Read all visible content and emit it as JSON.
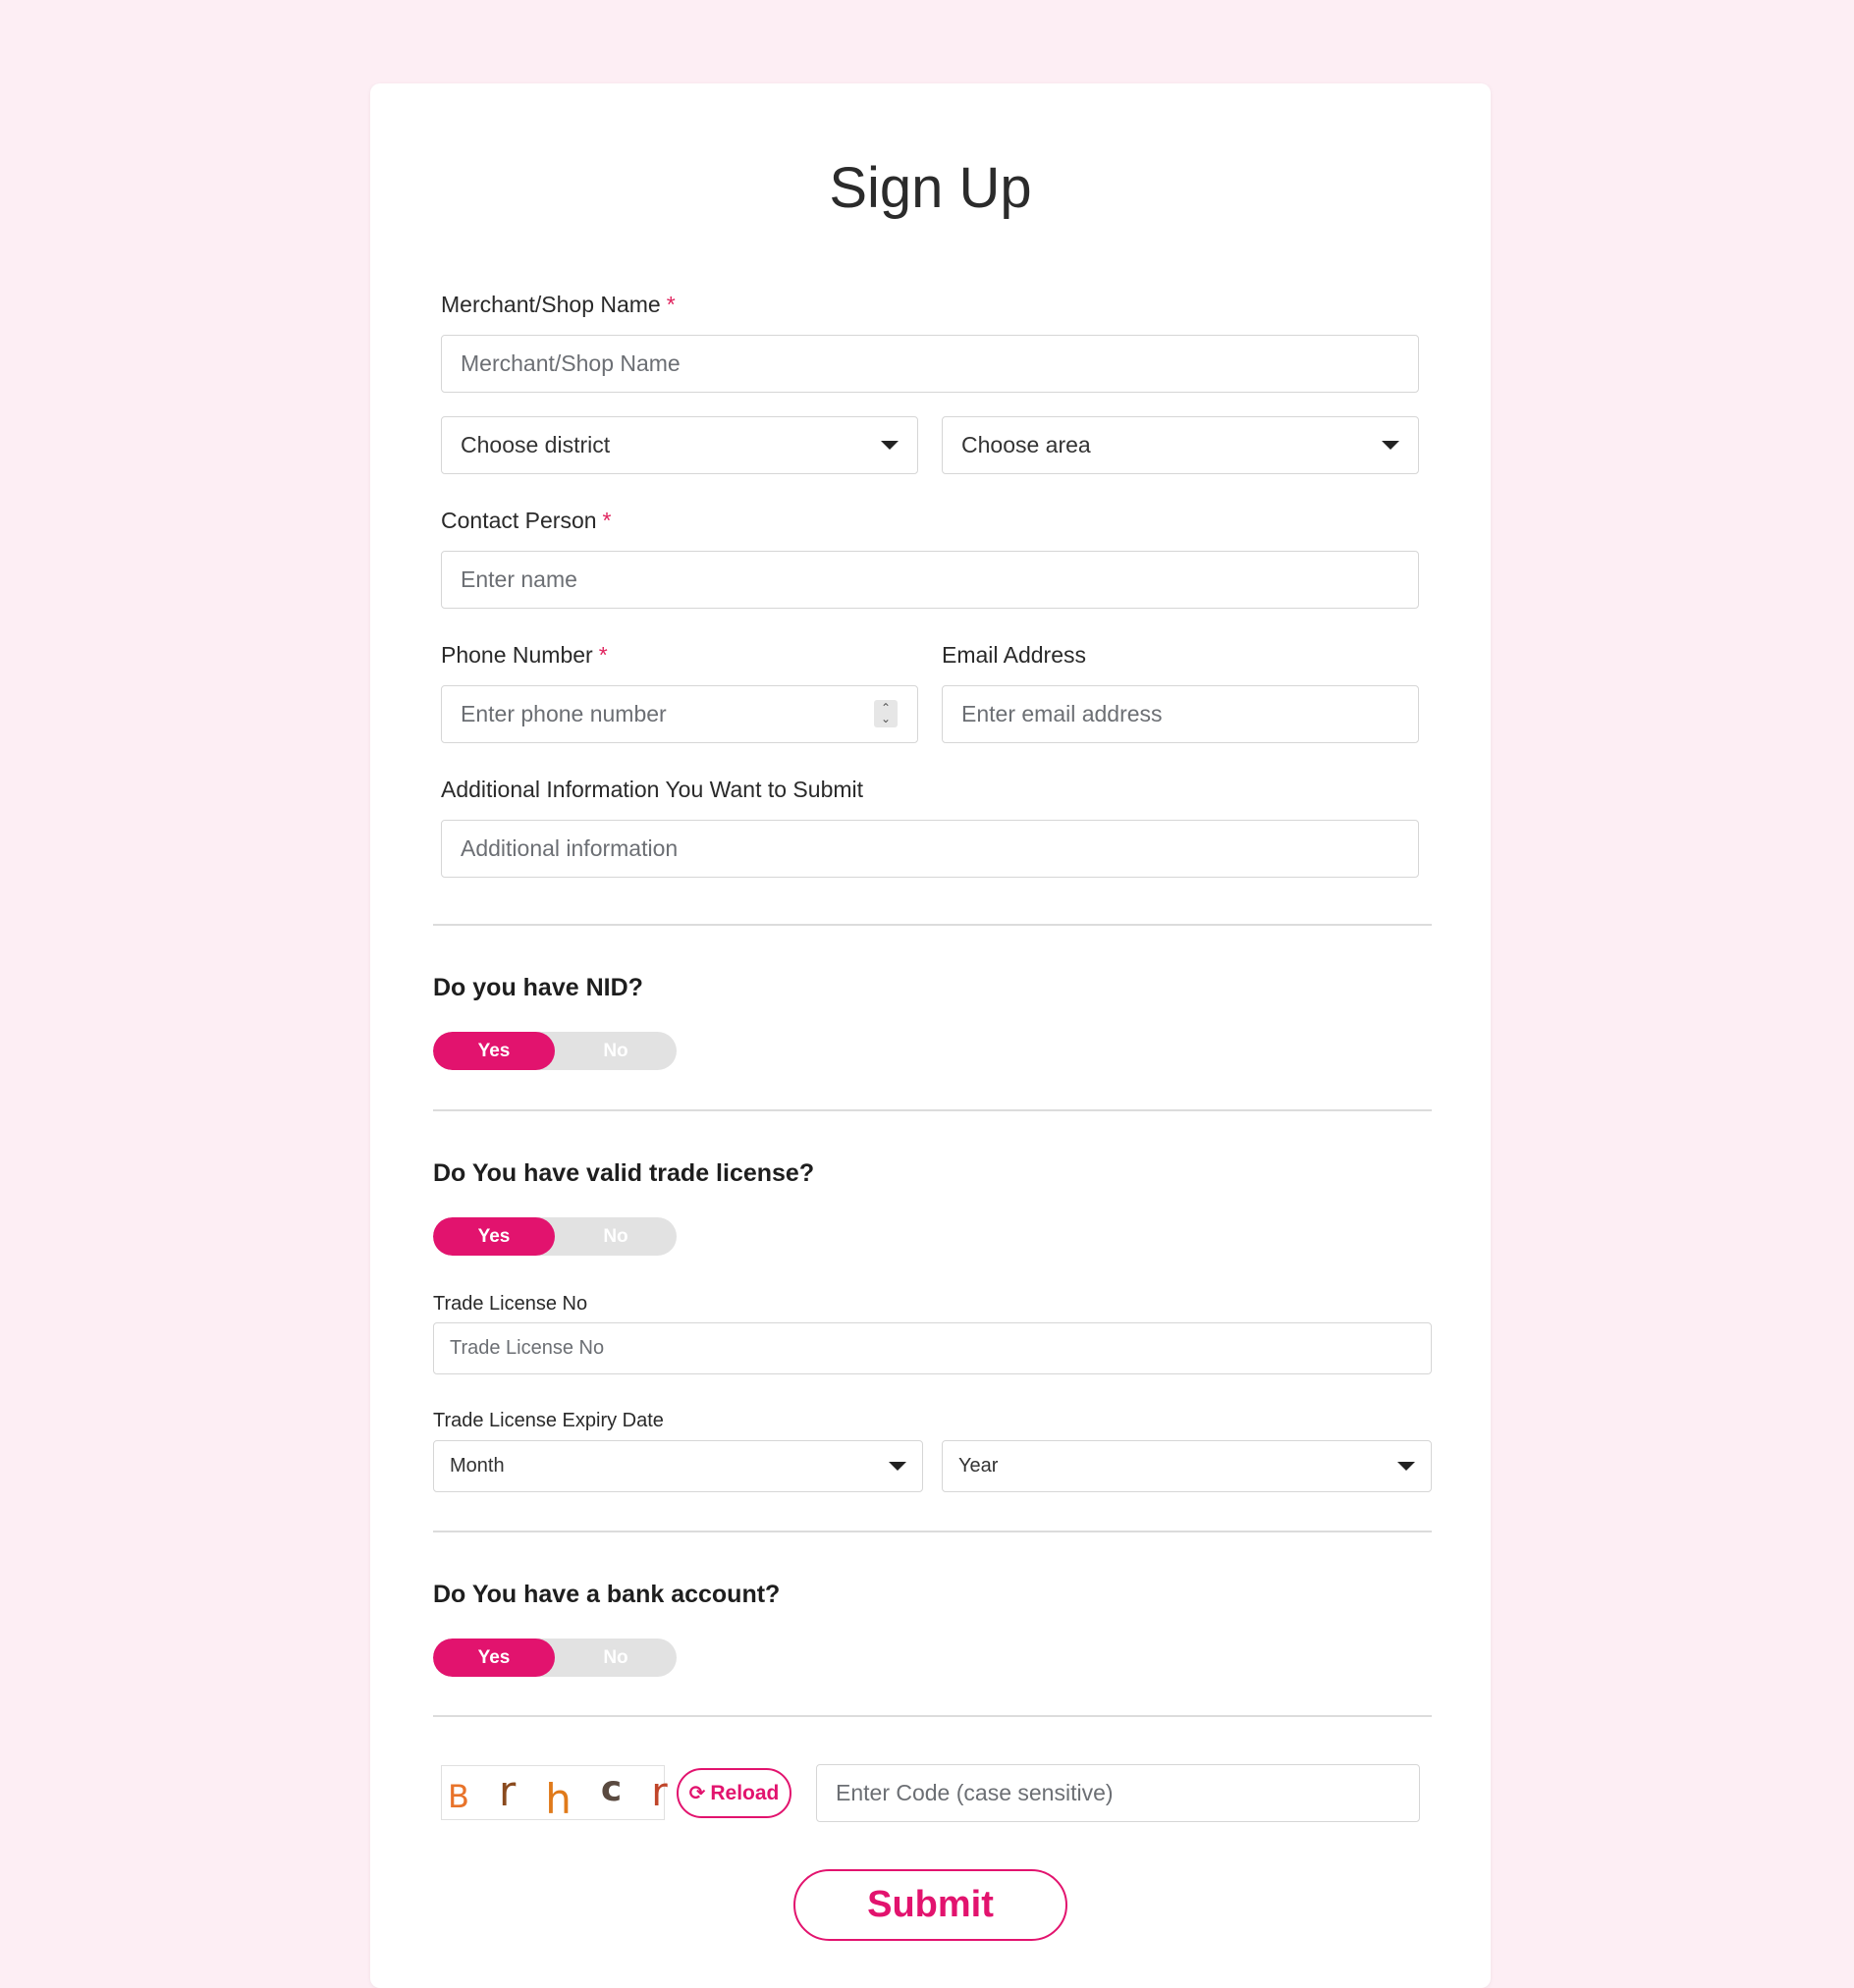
{
  "title": "Sign Up",
  "merchant": {
    "label": "Merchant/Shop Name",
    "required": "*",
    "placeholder": "Merchant/Shop Name"
  },
  "district": {
    "value": "Choose district"
  },
  "area": {
    "value": "Choose area"
  },
  "contact": {
    "label": "Contact Person",
    "required": "*",
    "placeholder": "Enter name"
  },
  "phone": {
    "label": "Phone Number",
    "required": "*",
    "placeholder": "Enter phone number"
  },
  "email": {
    "label": "Email Address",
    "placeholder": "Enter email address"
  },
  "additional": {
    "label": "Additional Information You Want to Submit",
    "placeholder": "Additional information"
  },
  "nid": {
    "question": "Do you have NID?",
    "yes": "Yes",
    "no": "No",
    "selected": "Yes"
  },
  "trade": {
    "question": "Do You have valid trade license?",
    "yes": "Yes",
    "no": "No",
    "selected": "Yes",
    "license_label": "Trade License No",
    "license_placeholder": "Trade License No",
    "expiry_label": "Trade License Expiry Date",
    "month": "Month",
    "year": "Year"
  },
  "bank": {
    "question": "Do You have a bank account?",
    "yes": "Yes",
    "no": "No",
    "selected": "Yes"
  },
  "captcha": {
    "chars": [
      {
        "char": "B",
        "color": "#e8732a"
      },
      {
        "char": "r",
        "color": "#8a4a1e"
      },
      {
        "char": "h",
        "color": "#e07a1a"
      },
      {
        "char": "c",
        "color": "#5a4a40"
      },
      {
        "char": "r",
        "color": "#c0452a"
      }
    ],
    "reload": "Reload",
    "placeholder": "Enter Code (case sensitive)"
  },
  "submit": "Submit",
  "colors": {
    "accent": "#e2136e",
    "background": "#fdeef4"
  }
}
